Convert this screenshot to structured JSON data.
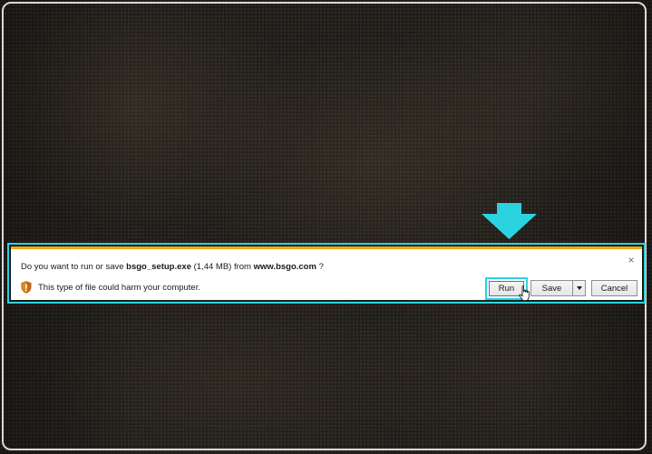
{
  "notification": {
    "question_prefix": "Do you want to run or save ",
    "file_name": "bsgo_setup.exe",
    "file_size": " (1,44 MB) from ",
    "source": "www.bsgo.com",
    "question_suffix": " ?",
    "warning": "This type of file could harm your computer.",
    "close_symbol": "×",
    "run_label": "Run",
    "save_label": "Save",
    "cancel_label": "Cancel"
  },
  "colors": {
    "highlight": "#2bd3e0",
    "notification_top_border": "#f0a81a",
    "background": "#1f1d1a"
  },
  "icons": {
    "arrow": "down-arrow-icon",
    "shield": "shield-warning-icon",
    "close": "close-icon",
    "dropdown": "chevron-down-icon",
    "cursor": "hand-pointer-icon"
  }
}
